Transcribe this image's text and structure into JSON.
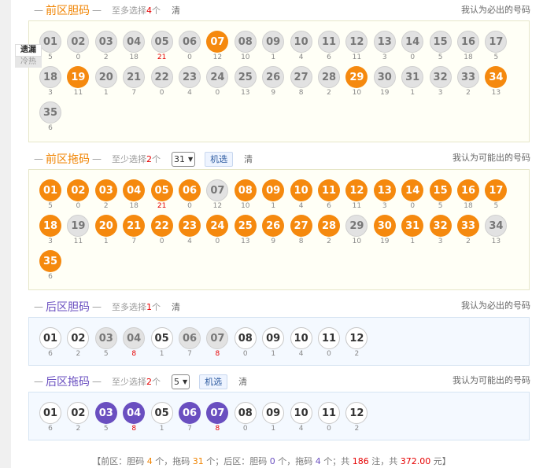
{
  "front_dan": {
    "title": "前区胆码",
    "hint_prefix": "至多选择",
    "hint_num": "4",
    "hint_suffix": "个",
    "clear": "清",
    "note": "我认为必出的号码",
    "balls": [
      {
        "n": "01",
        "m": "5",
        "s": "grey"
      },
      {
        "n": "02",
        "m": "0",
        "s": "grey"
      },
      {
        "n": "03",
        "m": "2",
        "s": "grey"
      },
      {
        "n": "04",
        "m": "18",
        "s": "grey"
      },
      {
        "n": "05",
        "m": "21",
        "s": "grey",
        "hot": true
      },
      {
        "n": "06",
        "m": "0",
        "s": "grey"
      },
      {
        "n": "07",
        "m": "12",
        "s": "orange"
      },
      {
        "n": "08",
        "m": "10",
        "s": "grey"
      },
      {
        "n": "09",
        "m": "1",
        "s": "grey"
      },
      {
        "n": "10",
        "m": "4",
        "s": "grey"
      },
      {
        "n": "11",
        "m": "6",
        "s": "grey"
      },
      {
        "n": "12",
        "m": "11",
        "s": "grey"
      },
      {
        "n": "13",
        "m": "3",
        "s": "grey"
      },
      {
        "n": "14",
        "m": "0",
        "s": "grey"
      },
      {
        "n": "15",
        "m": "5",
        "s": "grey"
      },
      {
        "n": "16",
        "m": "18",
        "s": "grey"
      },
      {
        "n": "17",
        "m": "5",
        "s": "grey"
      },
      {
        "n": "18",
        "m": "3",
        "s": "grey"
      },
      {
        "n": "19",
        "m": "11",
        "s": "orange"
      },
      {
        "n": "20",
        "m": "1",
        "s": "grey"
      },
      {
        "n": "21",
        "m": "7",
        "s": "grey"
      },
      {
        "n": "22",
        "m": "0",
        "s": "grey"
      },
      {
        "n": "23",
        "m": "4",
        "s": "grey"
      },
      {
        "n": "24",
        "m": "0",
        "s": "grey"
      },
      {
        "n": "25",
        "m": "13",
        "s": "grey"
      },
      {
        "n": "26",
        "m": "9",
        "s": "grey"
      },
      {
        "n": "27",
        "m": "8",
        "s": "grey"
      },
      {
        "n": "28",
        "m": "2",
        "s": "grey"
      },
      {
        "n": "29",
        "m": "10",
        "s": "orange"
      },
      {
        "n": "30",
        "m": "19",
        "s": "grey"
      },
      {
        "n": "31",
        "m": "1",
        "s": "grey"
      },
      {
        "n": "32",
        "m": "3",
        "s": "grey"
      },
      {
        "n": "33",
        "m": "2",
        "s": "grey"
      },
      {
        "n": "34",
        "m": "13",
        "s": "orange"
      },
      {
        "n": "35",
        "m": "6",
        "s": "grey"
      }
    ]
  },
  "side_tabs": {
    "miss": "遗漏",
    "hot": "冷热"
  },
  "front_tuo": {
    "title": "前区拖码",
    "hint_prefix": "至少选择",
    "hint_num": "2",
    "hint_suffix": "个",
    "select_value": "31",
    "random": "机选",
    "clear": "清",
    "note": "我认为可能出的号码",
    "balls": [
      {
        "n": "01",
        "m": "5",
        "s": "orange"
      },
      {
        "n": "02",
        "m": "0",
        "s": "orange"
      },
      {
        "n": "03",
        "m": "2",
        "s": "orange"
      },
      {
        "n": "04",
        "m": "18",
        "s": "orange"
      },
      {
        "n": "05",
        "m": "21",
        "s": "orange",
        "hot": true
      },
      {
        "n": "06",
        "m": "0",
        "s": "orange"
      },
      {
        "n": "07",
        "m": "12",
        "s": "grey"
      },
      {
        "n": "08",
        "m": "10",
        "s": "orange"
      },
      {
        "n": "09",
        "m": "1",
        "s": "orange"
      },
      {
        "n": "10",
        "m": "4",
        "s": "orange"
      },
      {
        "n": "11",
        "m": "6",
        "s": "orange"
      },
      {
        "n": "12",
        "m": "11",
        "s": "orange"
      },
      {
        "n": "13",
        "m": "3",
        "s": "orange"
      },
      {
        "n": "14",
        "m": "0",
        "s": "orange"
      },
      {
        "n": "15",
        "m": "5",
        "s": "orange"
      },
      {
        "n": "16",
        "m": "18",
        "s": "orange"
      },
      {
        "n": "17",
        "m": "5",
        "s": "orange"
      },
      {
        "n": "18",
        "m": "3",
        "s": "orange"
      },
      {
        "n": "19",
        "m": "11",
        "s": "grey"
      },
      {
        "n": "20",
        "m": "1",
        "s": "orange"
      },
      {
        "n": "21",
        "m": "7",
        "s": "orange"
      },
      {
        "n": "22",
        "m": "0",
        "s": "orange"
      },
      {
        "n": "23",
        "m": "4",
        "s": "orange"
      },
      {
        "n": "24",
        "m": "0",
        "s": "orange"
      },
      {
        "n": "25",
        "m": "13",
        "s": "orange"
      },
      {
        "n": "26",
        "m": "9",
        "s": "orange"
      },
      {
        "n": "27",
        "m": "8",
        "s": "orange"
      },
      {
        "n": "28",
        "m": "2",
        "s": "orange"
      },
      {
        "n": "29",
        "m": "10",
        "s": "grey"
      },
      {
        "n": "30",
        "m": "19",
        "s": "orange"
      },
      {
        "n": "31",
        "m": "1",
        "s": "orange"
      },
      {
        "n": "32",
        "m": "3",
        "s": "orange"
      },
      {
        "n": "33",
        "m": "2",
        "s": "orange"
      },
      {
        "n": "34",
        "m": "13",
        "s": "grey"
      },
      {
        "n": "35",
        "m": "6",
        "s": "orange"
      }
    ]
  },
  "back_dan": {
    "title": "后区胆码",
    "hint_prefix": "至多选择",
    "hint_num": "1",
    "hint_suffix": "个",
    "clear": "清",
    "note": "我认为必出的号码",
    "balls": [
      {
        "n": "01",
        "m": "6",
        "s": "white"
      },
      {
        "n": "02",
        "m": "2",
        "s": "white"
      },
      {
        "n": "03",
        "m": "5",
        "s": "grey"
      },
      {
        "n": "04",
        "m": "8",
        "s": "grey",
        "hot": true
      },
      {
        "n": "05",
        "m": "1",
        "s": "white"
      },
      {
        "n": "06",
        "m": "7",
        "s": "grey"
      },
      {
        "n": "07",
        "m": "8",
        "s": "grey",
        "hot": true
      },
      {
        "n": "08",
        "m": "0",
        "s": "white"
      },
      {
        "n": "09",
        "m": "1",
        "s": "white"
      },
      {
        "n": "10",
        "m": "4",
        "s": "white"
      },
      {
        "n": "11",
        "m": "0",
        "s": "white"
      },
      {
        "n": "12",
        "m": "2",
        "s": "white"
      }
    ]
  },
  "back_tuo": {
    "title": "后区拖码",
    "hint_prefix": "至少选择",
    "hint_num": "2",
    "hint_suffix": "个",
    "select_value": "5",
    "random": "机选",
    "clear": "清",
    "note": "我认为可能出的号码",
    "balls": [
      {
        "n": "01",
        "m": "6",
        "s": "white"
      },
      {
        "n": "02",
        "m": "2",
        "s": "white"
      },
      {
        "n": "03",
        "m": "5",
        "s": "purple"
      },
      {
        "n": "04",
        "m": "8",
        "s": "purple",
        "hot": true
      },
      {
        "n": "05",
        "m": "1",
        "s": "white"
      },
      {
        "n": "06",
        "m": "7",
        "s": "purple"
      },
      {
        "n": "07",
        "m": "8",
        "s": "purple",
        "hot": true
      },
      {
        "n": "08",
        "m": "0",
        "s": "white"
      },
      {
        "n": "09",
        "m": "1",
        "s": "white"
      },
      {
        "n": "10",
        "m": "4",
        "s": "white"
      },
      {
        "n": "11",
        "m": "0",
        "s": "white"
      },
      {
        "n": "12",
        "m": "2",
        "s": "white"
      }
    ]
  },
  "summary": {
    "p1": "【前区：胆码 ",
    "front_dan_count": "4",
    "p2": " 个，拖码 ",
    "front_tuo_count": "31",
    "p3": " 个；后区：胆码 ",
    "back_dan_count": "0",
    "p4": " 个，拖码 ",
    "back_tuo_count": "4",
    "p5": " 个；共 ",
    "bets": "186",
    "p6": " 注，共 ",
    "amount": "372.00",
    "p7": " 元】"
  }
}
